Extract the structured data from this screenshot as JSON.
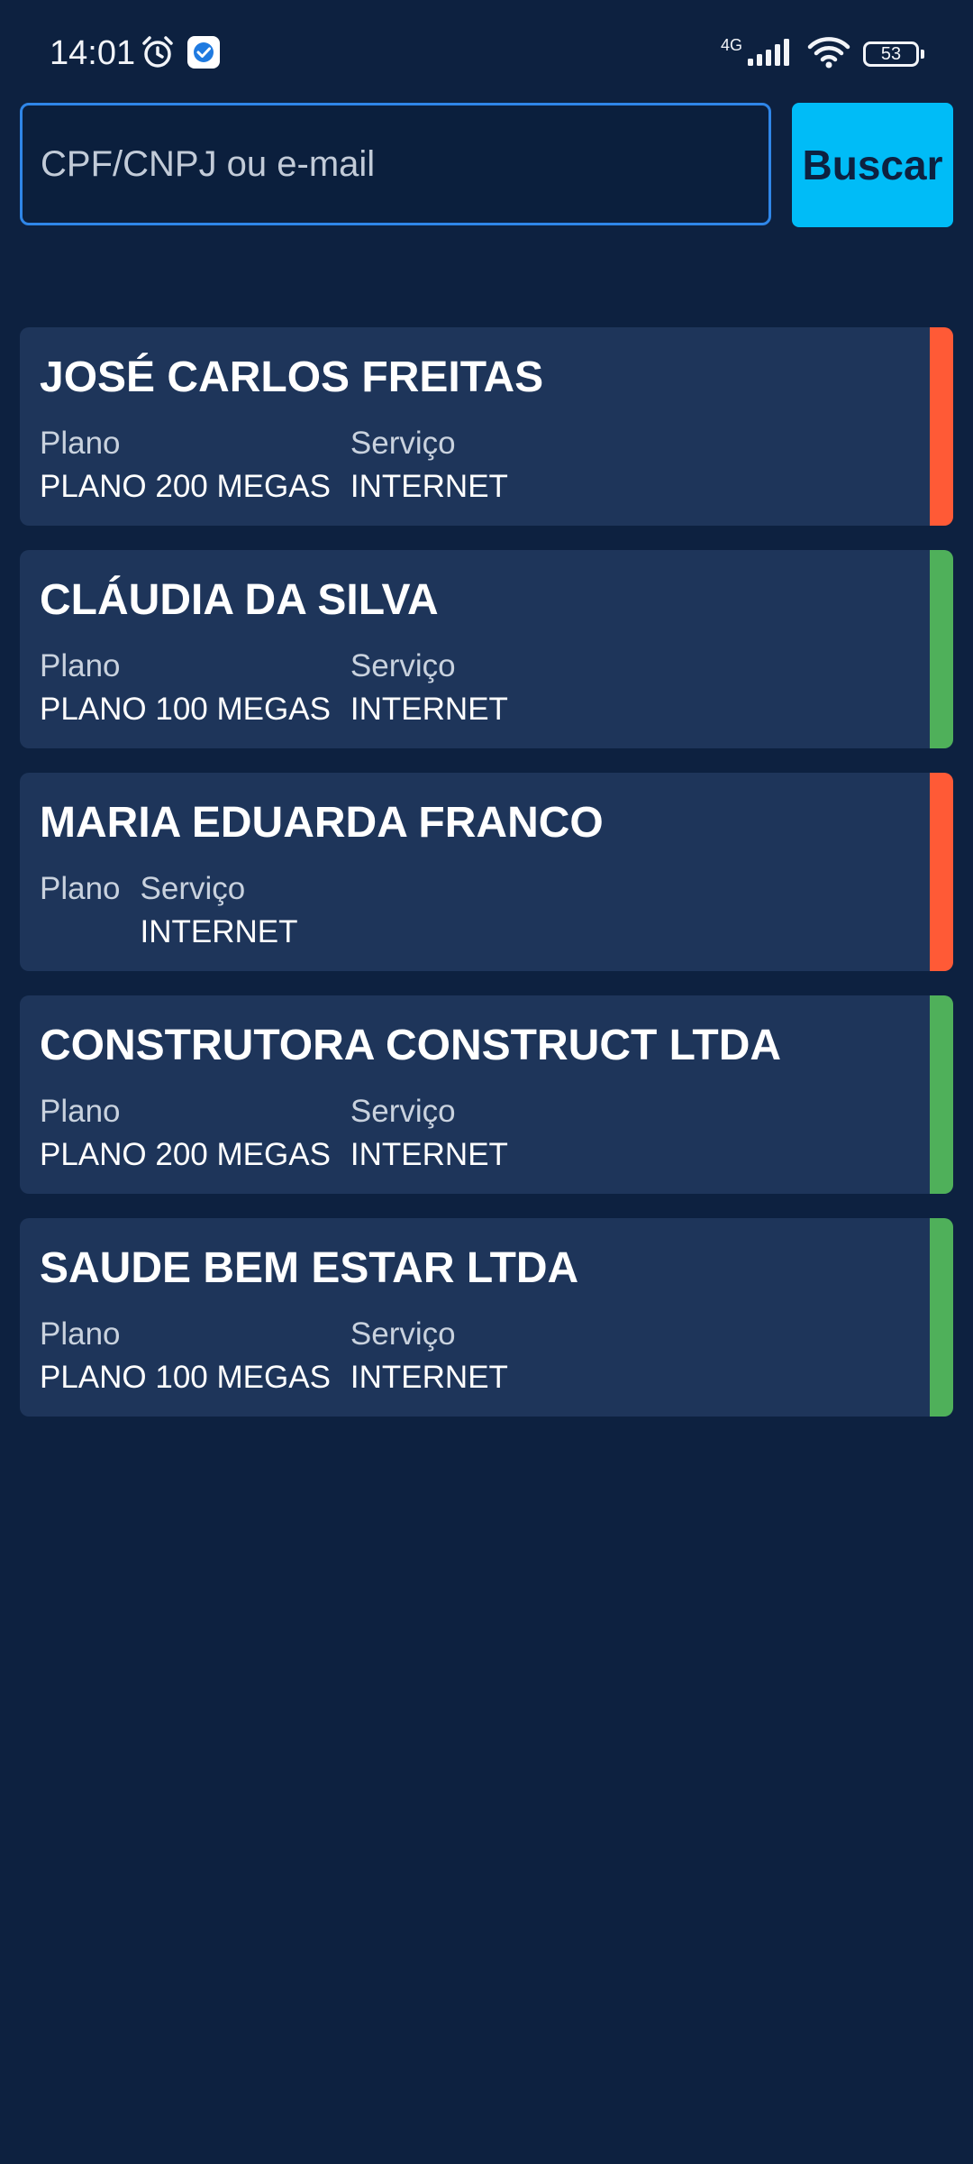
{
  "status_bar": {
    "time": "14:01",
    "network": "4G",
    "battery": "53"
  },
  "search": {
    "placeholder": "CPF/CNPJ ou e-mail",
    "value": "",
    "button_label": "Buscar"
  },
  "colors": {
    "background": "#0d2140",
    "card": "#1e355a",
    "accent": "#00bcf7",
    "input_border": "#2f86e8",
    "status_red": "#ff5a36",
    "status_green": "#4fb05a"
  },
  "customers": [
    {
      "name": "JOSÉ CARLOS FREITAS",
      "plan_label": "Plano",
      "plan": "PLANO 200 MEGAS",
      "service_label": "Serviço",
      "service": "INTERNET",
      "status_color": "#ff5a36"
    },
    {
      "name": "CLÁUDIA DA SILVA",
      "plan_label": "Plano",
      "plan": "PLANO 100 MEGAS",
      "service_label": "Serviço",
      "service": "INTERNET",
      "status_color": "#4fb05a"
    },
    {
      "name": "MARIA EDUARDA FRANCO",
      "plan_label": "Plano",
      "plan": "",
      "service_label": "Serviço",
      "service": "INTERNET",
      "status_color": "#ff5a36"
    },
    {
      "name": "CONSTRUTORA CONSTRUCT LTDA",
      "plan_label": "Plano",
      "plan": "PLANO 200 MEGAS",
      "service_label": "Serviço",
      "service": "INTERNET",
      "status_color": "#4fb05a"
    },
    {
      "name": "SAUDE BEM ESTAR LTDA",
      "plan_label": "Plano",
      "plan": "PLANO 100 MEGAS",
      "service_label": "Serviço",
      "service": "INTERNET",
      "status_color": "#4fb05a"
    }
  ]
}
